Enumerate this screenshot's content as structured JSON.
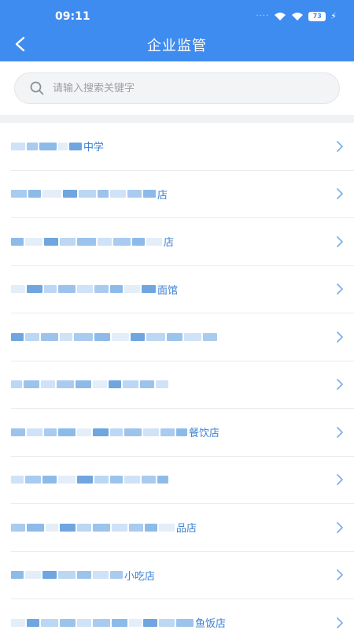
{
  "status": {
    "time": "09:11",
    "battery": "73"
  },
  "nav": {
    "title": "企业监管"
  },
  "search": {
    "placeholder": "请输入搜索关键字"
  },
  "items": [
    {
      "suffix": "中学",
      "blur": [
        18,
        14,
        22,
        12,
        16
      ]
    },
    {
      "suffix": "店",
      "blur": [
        20,
        16,
        24,
        18,
        22,
        14,
        20,
        18,
        16
      ]
    },
    {
      "suffix": "店",
      "blur": [
        16,
        22,
        18,
        20,
        24,
        18,
        22,
        16,
        20
      ]
    },
    {
      "suffix": "面馆",
      "blur": [
        18,
        20,
        16,
        22,
        20,
        18,
        16,
        20,
        18
      ]
    },
    {
      "suffix": "",
      "blur": [
        16,
        18,
        22,
        16,
        24,
        20,
        22,
        18,
        24,
        20,
        22,
        18
      ]
    },
    {
      "suffix": "",
      "blur": [
        14,
        20,
        18,
        22,
        20,
        18,
        16,
        20,
        18,
        16
      ]
    },
    {
      "suffix": "餐饮店",
      "blur": [
        18,
        20,
        16,
        22,
        18,
        20,
        16,
        22,
        20,
        18,
        14
      ]
    },
    {
      "suffix": "",
      "blur": [
        16,
        20,
        18,
        22,
        20,
        18,
        16,
        20,
        18,
        14
      ]
    },
    {
      "suffix": "品店",
      "blur": [
        18,
        22,
        16,
        20,
        18,
        22,
        20,
        18,
        16,
        20
      ]
    },
    {
      "suffix": "小吃店",
      "blur": [
        16,
        20,
        18,
        22,
        18,
        20,
        16
      ]
    },
    {
      "suffix": "鱼饭店",
      "blur": [
        18,
        16,
        22,
        20,
        18,
        22,
        20,
        16,
        18,
        20,
        22
      ]
    }
  ],
  "colors": {
    "header": "#3f8cf0",
    "link_text": "#3d82d4",
    "chevron": "#7fb0ee"
  }
}
